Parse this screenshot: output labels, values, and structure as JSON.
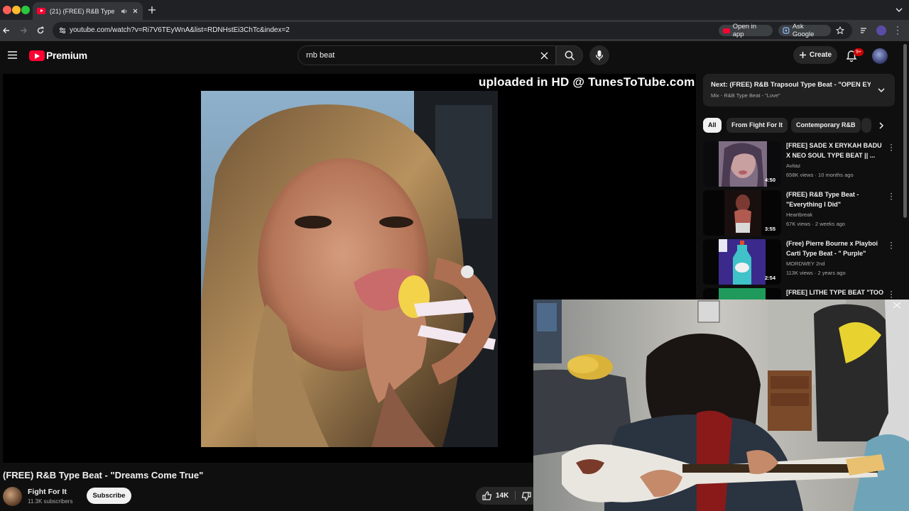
{
  "browser": {
    "tab_title": "(21) (FREE) R&B Type Be",
    "url": "youtube.com/watch?v=Ri7V6TEyWnA&list=RDNHstEi3ChTc&index=2",
    "open_in_app": "Open in app",
    "ask_google": "Ask Google"
  },
  "header": {
    "logo": "Premium",
    "search_value": "rnb beat",
    "create_label": "Create",
    "notif_count": "9+"
  },
  "player": {
    "watermark": "uploaded in HD @ TunesToTube.com"
  },
  "video": {
    "title": "(FREE) R&B Type Beat - \"Dreams Come True\"",
    "channel": "Fight For It",
    "subscribers": "11.3K subscribers",
    "subscribe_label": "Subscribe",
    "likes": "14K"
  },
  "sidebar": {
    "next_title": "Next: (FREE) R&B Trapsoul Type Beat - \"OPEN EYES...",
    "next_sub": "Mix - R&B Type Beat - \"Love\"",
    "chips": [
      "All",
      "From Fight For It",
      "Contemporary R&B"
    ],
    "recs": [
      {
        "title": "[FREE] SADE X ERYKAH BADU X NEO SOUL TYPE BEAT || ...",
        "channel": "Avitaz",
        "meta": "658K views · 10 months ago",
        "duration": "4:50"
      },
      {
        "title": "(FREE) R&B Type Beat - \"Everything I Did\"",
        "channel": "Heartbreak",
        "meta": "67K views · 2 weeks ago",
        "duration": "3:55"
      },
      {
        "title": "(Free) Pierre Bourne x Playboi Carti Type Beat - \" Purple\"",
        "channel": "MORDWEY 2nd",
        "meta": "113K views · 2 years ago",
        "duration": "2:54"
      },
      {
        "title": "[FREE] LITHE TYPE BEAT \"TOO",
        "channel": "",
        "meta": "",
        "duration": ""
      }
    ]
  },
  "colors": {
    "bg": "#0f0f0f",
    "brand_red": "#ff0033",
    "chip_bg": "#272727"
  }
}
